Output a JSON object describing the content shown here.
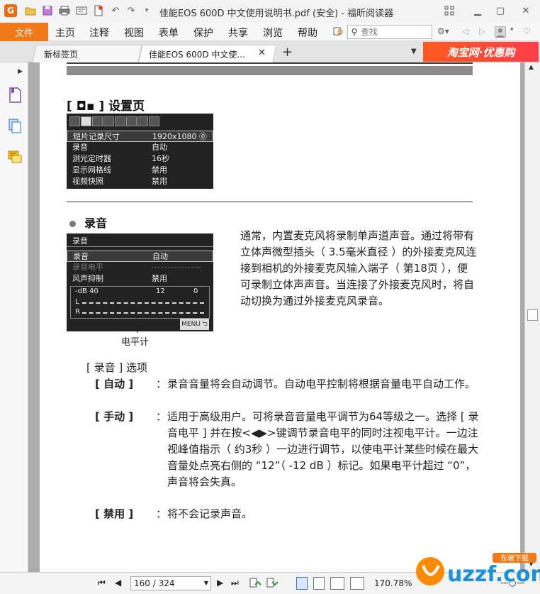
{
  "app": {
    "title": "佳能EOS 600D 中文使用说明书.pdf (安全) - 福昕阅读器",
    "logo": "G"
  },
  "menubar": {
    "file": "文件",
    "items": [
      "主页",
      "注释",
      "视图",
      "表单",
      "保护",
      "共享",
      "浏览",
      "帮助"
    ],
    "search_placeholder": "查找"
  },
  "tabs": [
    {
      "label": "新标签页"
    },
    {
      "label": "佳能EOS 600D 中文使..."
    }
  ],
  "ad": {
    "text": "淘宝网·优惠购"
  },
  "page_content": {
    "section_title": "[ ◘▪ ] 设置页",
    "lcd1": {
      "rows": [
        {
          "label": "短片记录尺寸",
          "value": "1920x1080 ⓪"
        },
        {
          "label": "录音",
          "value": "自动"
        },
        {
          "label": "测光定时器",
          "value": "16秒"
        },
        {
          "label": "显示网格线",
          "value": "禁用"
        },
        {
          "label": "视频快照",
          "value": "禁用"
        }
      ]
    },
    "bullet_title": "录音",
    "lcd2": {
      "header": "录音",
      "rows": [
        {
          "label": "录音",
          "value": "自动"
        },
        {
          "label": "录音电平",
          "value": ""
        },
        {
          "label": "风声抑制",
          "value": "禁用"
        }
      ],
      "meter_scale": [
        "-dB 40",
        "12",
        "0"
      ],
      "meter_channels": [
        "L",
        "R"
      ],
      "menu_label": "MENU ⮌"
    },
    "meter_caption": "电平计",
    "paragraph": "通常，内置麦克风将录制单声道声音。通过将带有立体声微型插头（ 3.5毫米直径 ）的外接麦克风连接到相机的外接麦克风输入端子（ 第18页 ），便可录制立体声声音。当连接了外接麦克风时，将自动切换为通过外接麦克风录音。",
    "options_heading": "[ 录音 ] 选项",
    "options": [
      {
        "key": "[ 自动 ]",
        "sep": "：",
        "desc": "录音音量将会自动调节。自动电平控制将根据音量电平自动工作。"
      },
      {
        "key": "[ 手动 ]",
        "sep": "：",
        "desc": "适用于高级用户。可将录音音量电平调节为64等级之一。选择 [ 录音电平 ] 并在按<◀▶>键调节录音电平的同时注视电平计。一边注视峰值指示（ 约3秒 ）一边进行调节，以使电平计某些时候在最大音量处点亮右侧的 “12”（ -12 dB ）标记。如果电平计超过 “0”，声音将会失真。"
      },
      {
        "key": "[ 禁用 ]",
        "sep": "：",
        "desc": "将不会记录声音。"
      }
    ]
  },
  "statusbar": {
    "page_display": "160 / 324",
    "zoom": "170.78%"
  },
  "watermark": {
    "text": "uzzf.com",
    "sub": "东坡下载"
  },
  "colors": {
    "accent": "#f07817",
    "page_bg": "#ffffff",
    "doc_bg": "#ababab"
  }
}
